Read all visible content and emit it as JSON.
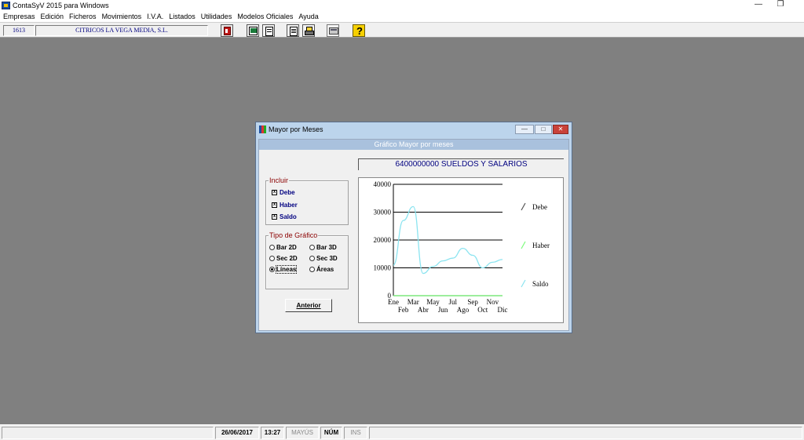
{
  "window": {
    "title": "ContaSyV 2015 para Windows",
    "minimize": "—",
    "restore": "❐"
  },
  "menu": [
    "Empresas",
    "Edición",
    "Ficheros",
    "Movimientos",
    "I.V.A.",
    "Listados",
    "Utilidades",
    "Modelos Oficiales",
    "Ayuda"
  ],
  "toolbar": {
    "company_code": "1613",
    "company_name": "CITRICOS LA VEGA MEDIA, S.L."
  },
  "dialog": {
    "title": "Mayor por Meses",
    "controls": {
      "minimize": "—",
      "maximize": "□",
      "close": "✕"
    },
    "header": "Gráfico Mayor por meses",
    "account": "6400000000   SUELDOS Y SALARIOS",
    "incluir": {
      "title": "Incluir",
      "items": [
        {
          "label": "Debe",
          "mark": "x"
        },
        {
          "label": "Haber",
          "mark": "x"
        },
        {
          "label": "Saldo",
          "mark": "x"
        }
      ]
    },
    "tipo": {
      "title": "Tipo de Gráfico",
      "options": [
        "Bar 2D",
        "Bar 3D",
        "Sec 2D",
        "Sec 3D",
        "Líneas",
        "Áreas"
      ],
      "selected": "Líneas"
    },
    "button_anterior": "Anterior"
  },
  "chart_data": {
    "type": "line",
    "categories": [
      "Ene",
      "Feb",
      "Mar",
      "Abr",
      "May",
      "Jun",
      "Jul",
      "Ago",
      "Sep",
      "Oct",
      "Nov",
      "Dic"
    ],
    "series": [
      {
        "name": "Debe",
        "color": "#555555",
        "values": [
          0,
          0,
          0,
          0,
          0,
          0,
          0,
          0,
          0,
          0,
          0,
          0
        ]
      },
      {
        "name": "Haber",
        "color": "#7CFC7C",
        "values": [
          0,
          0,
          0,
          0,
          0,
          0,
          0,
          0,
          0,
          0,
          0,
          0
        ]
      },
      {
        "name": "Saldo",
        "color": "#8BE4F0",
        "values": [
          11000,
          27000,
          32000,
          8000,
          10500,
          12500,
          13500,
          17000,
          14500,
          10000,
          12000,
          13000
        ]
      }
    ],
    "yticks": [
      0,
      10000,
      20000,
      30000,
      40000
    ],
    "ylim": [
      0,
      40000
    ],
    "grid": true,
    "legend": "right"
  },
  "status": {
    "date": "26/06/2017",
    "time": "13:27",
    "caps": "MAYÚS",
    "num": "NÚM",
    "ins": "INS"
  }
}
